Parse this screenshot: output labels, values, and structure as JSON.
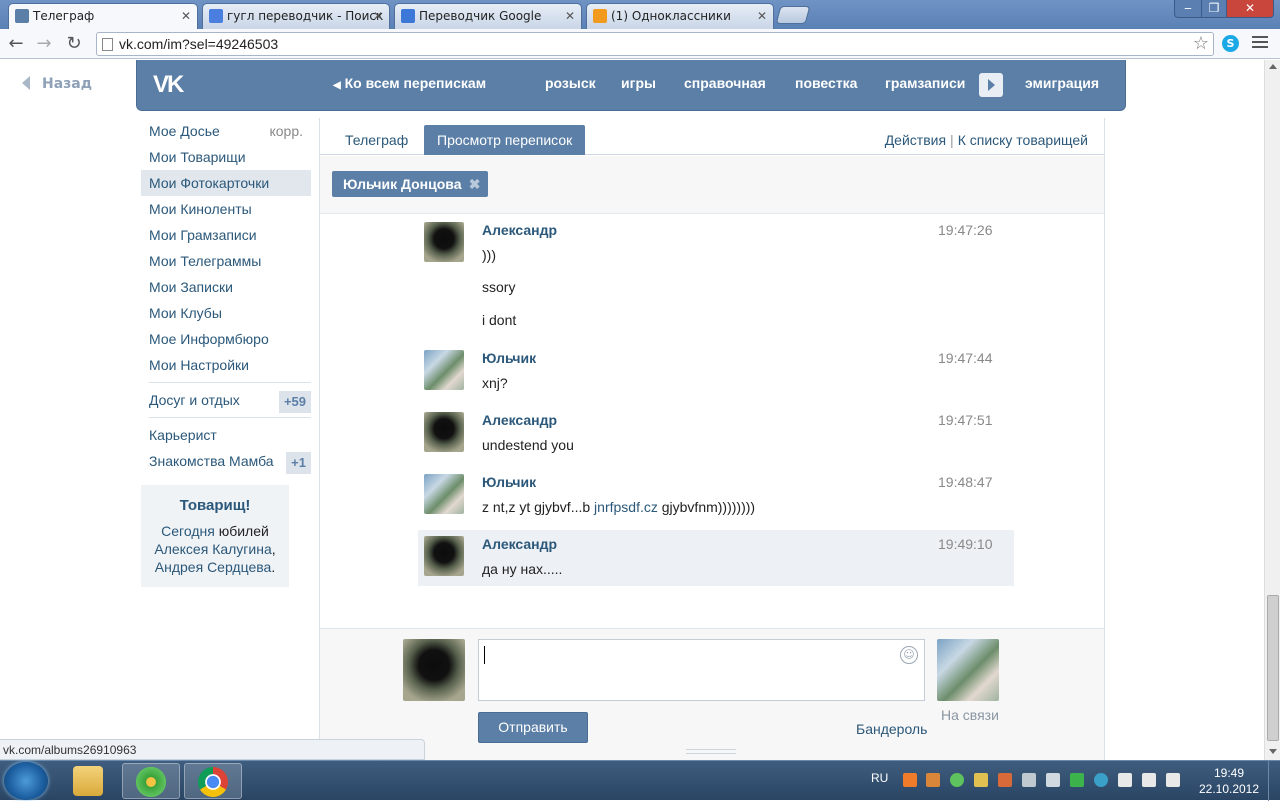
{
  "browser": {
    "tabs": [
      {
        "title": "Телеграф",
        "active": true,
        "favicon": "vk-message-icon"
      },
      {
        "title": "гугл переводчик - Поиск",
        "active": false,
        "favicon": "google-icon"
      },
      {
        "title": "Переводчик Google",
        "active": false,
        "favicon": "google-translate-icon"
      },
      {
        "title": "(1) Одноклассники",
        "active": false,
        "favicon": "odnoklassniki-icon"
      }
    ],
    "address": "vk.com/im?sel=49246503",
    "status_url": "vk.com/albums26910963"
  },
  "page": {
    "back_label": "Назад",
    "header": {
      "logo": "VK",
      "all_chats": "Ко всем перепискам",
      "nav": [
        "розыск",
        "игры",
        "справочная",
        "повестка",
        "грамзаписи",
        "эмиграция"
      ]
    },
    "left_menu": [
      {
        "label": "Мое Досье",
        "aux": "корр."
      },
      {
        "label": "Мои Товарищи"
      },
      {
        "label": "Мои Фотокарточки",
        "selected": true
      },
      {
        "label": "Мои Киноленты"
      },
      {
        "label": "Мои Грамзаписи"
      },
      {
        "label": "Мои Телеграммы"
      },
      {
        "label": "Мои Записки"
      },
      {
        "label": "Мои Клубы"
      },
      {
        "label": "Мое Информбюро"
      },
      {
        "label": "Мои Настройки"
      }
    ],
    "apps": [
      {
        "label": "Досуг и отдых",
        "count": "+59"
      },
      {
        "label": "Карьерист"
      },
      {
        "label": "Знакомства Мамба",
        "count": "+1"
      }
    ],
    "promo": {
      "title": "Товарищ!",
      "line_pre": "Сегодня",
      "line_mid": "юбилей",
      "link1": "Алексея Калугина",
      "comma": ",",
      "link2": "Андрея Сердцева",
      "dot": "."
    },
    "tabs": [
      "Телеграф",
      "Просмотр переписок"
    ],
    "actions": [
      "Действия",
      "К списку товарищей"
    ],
    "peer_chip": "Юльчик Донцова",
    "messages": [
      {
        "author": "Александр",
        "time": "19:47:26",
        "avatar": "dark",
        "lines": [
          ")))",
          "ssory",
          "i dont"
        ]
      },
      {
        "author": "Юльчик",
        "time": "19:47:44",
        "avatar": "light",
        "lines": [
          "xnj?"
        ]
      },
      {
        "author": "Александр",
        "time": "19:47:51",
        "avatar": "dark",
        "lines": [
          "undestend you"
        ]
      },
      {
        "author": "Юльчик",
        "time": "19:48:47",
        "avatar": "light",
        "text_pre": "z nt,z yt gjybvf...b",
        "link": "jnrfpsdf.cz",
        "text_post": "gjybvfnm))))))))"
      },
      {
        "author": "Александр",
        "time": "19:49:10",
        "avatar": "dark",
        "lines": [
          "да ну нах....."
        ],
        "highlighted": true
      }
    ],
    "composer": {
      "send": "Отправить",
      "parcel": "Бандероль",
      "online": "На связи"
    }
  },
  "taskbar": {
    "lang": "RU",
    "time": "19:49",
    "date": "22.10.2012"
  },
  "colors": {
    "vk_blue": "#5b7fa6",
    "link": "#2b587a"
  }
}
